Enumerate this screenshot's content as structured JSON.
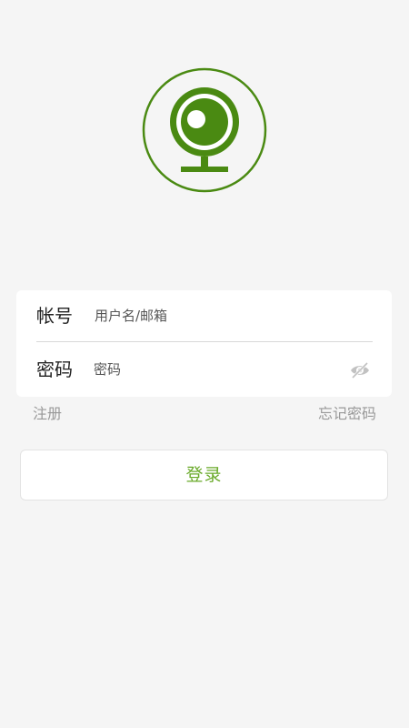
{
  "logo": {
    "icon": "webcam-icon",
    "color": "#4a8a12"
  },
  "form": {
    "account": {
      "label": "帐号",
      "placeholder": "用户名/邮箱",
      "value": ""
    },
    "password": {
      "label": "密码",
      "placeholder": "密码",
      "value": "",
      "toggle_icon": "eye-hidden-icon"
    }
  },
  "links": {
    "register": "注册",
    "forgot_password": "忘记密码"
  },
  "login_button": {
    "label": "登录",
    "color": "#6aaa2a"
  }
}
